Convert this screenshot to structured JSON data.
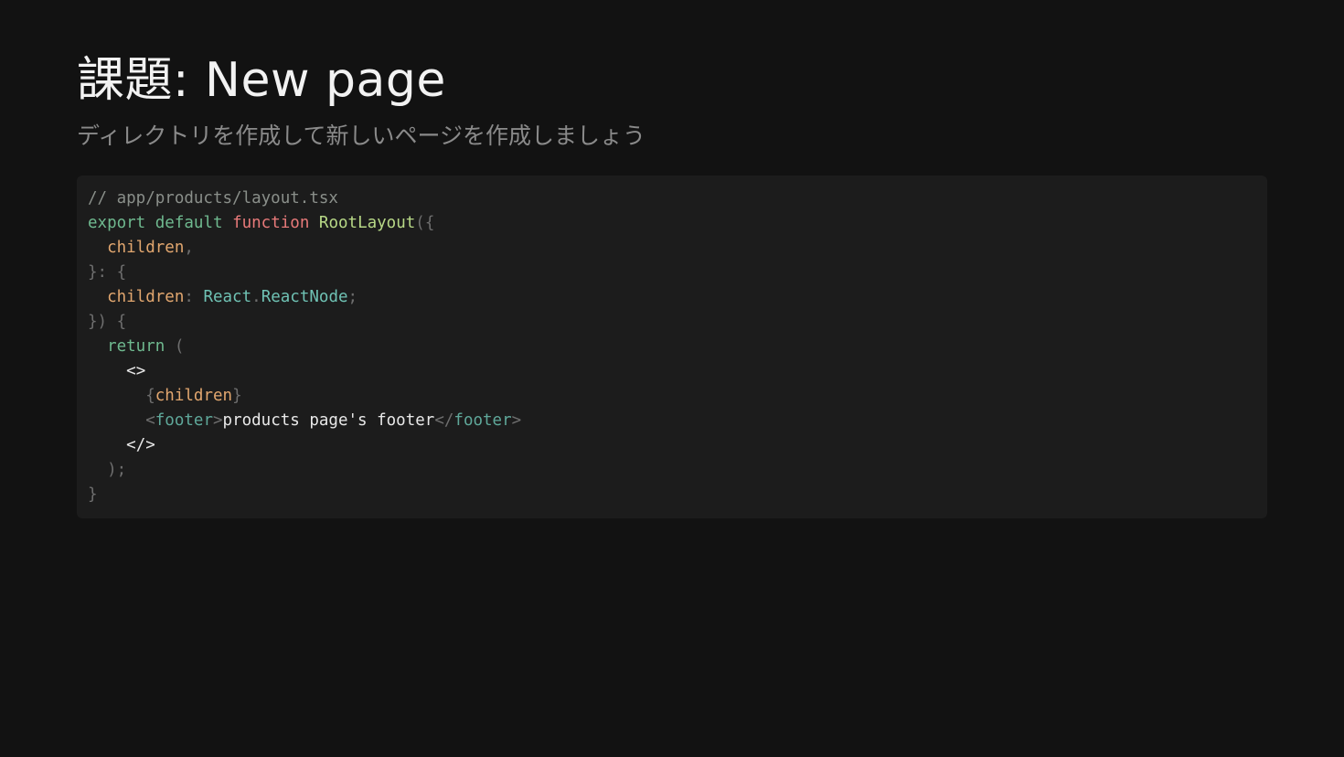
{
  "slide": {
    "title": "課題: New page",
    "subtitle": "ディレクトリを作成して新しいページを作成しましょう"
  },
  "code": {
    "language": "tsx",
    "lines": [
      [
        {
          "t": "// app/products/layout.tsx",
          "c": "comment"
        }
      ],
      [
        {
          "t": "export",
          "c": "kw"
        },
        {
          "t": " ",
          "c": "punct"
        },
        {
          "t": "default",
          "c": "kw"
        },
        {
          "t": " ",
          "c": "punct"
        },
        {
          "t": "function",
          "c": "fnkw"
        },
        {
          "t": " ",
          "c": "punct"
        },
        {
          "t": "RootLayout",
          "c": "fnname"
        },
        {
          "t": "({",
          "c": "punct"
        }
      ],
      [
        {
          "t": "  ",
          "c": "punct"
        },
        {
          "t": "children",
          "c": "param"
        },
        {
          "t": ",",
          "c": "punct"
        }
      ],
      [
        {
          "t": "}: {",
          "c": "punct"
        }
      ],
      [
        {
          "t": "  ",
          "c": "punct"
        },
        {
          "t": "children",
          "c": "param"
        },
        {
          "t": ": ",
          "c": "punct"
        },
        {
          "t": "React",
          "c": "type"
        },
        {
          "t": ".",
          "c": "punct"
        },
        {
          "t": "ReactNode",
          "c": "type"
        },
        {
          "t": ";",
          "c": "punct"
        }
      ],
      [
        {
          "t": "}) {",
          "c": "punct"
        }
      ],
      [
        {
          "t": "  ",
          "c": "punct"
        },
        {
          "t": "return",
          "c": "kw"
        },
        {
          "t": " (",
          "c": "punct"
        }
      ],
      [
        {
          "t": "    ",
          "c": "punct"
        },
        {
          "t": "<>",
          "c": "text"
        }
      ],
      [
        {
          "t": "      {",
          "c": "punct"
        },
        {
          "t": "children",
          "c": "param"
        },
        {
          "t": "}",
          "c": "punct"
        }
      ],
      [
        {
          "t": "      <",
          "c": "punct"
        },
        {
          "t": "footer",
          "c": "tag"
        },
        {
          "t": ">",
          "c": "punct"
        },
        {
          "t": "products page's footer",
          "c": "text"
        },
        {
          "t": "</",
          "c": "punct"
        },
        {
          "t": "footer",
          "c": "tag"
        },
        {
          "t": ">",
          "c": "punct"
        }
      ],
      [
        {
          "t": "    ",
          "c": "punct"
        },
        {
          "t": "</>",
          "c": "text"
        }
      ],
      [
        {
          "t": "  );",
          "c": "punct"
        }
      ],
      [
        {
          "t": "}",
          "c": "punct"
        }
      ]
    ]
  },
  "colors": {
    "background": "#121212",
    "code_background": "#1c1c1c",
    "title": "#f2f2f2",
    "subtitle": "#8a8a8a"
  }
}
